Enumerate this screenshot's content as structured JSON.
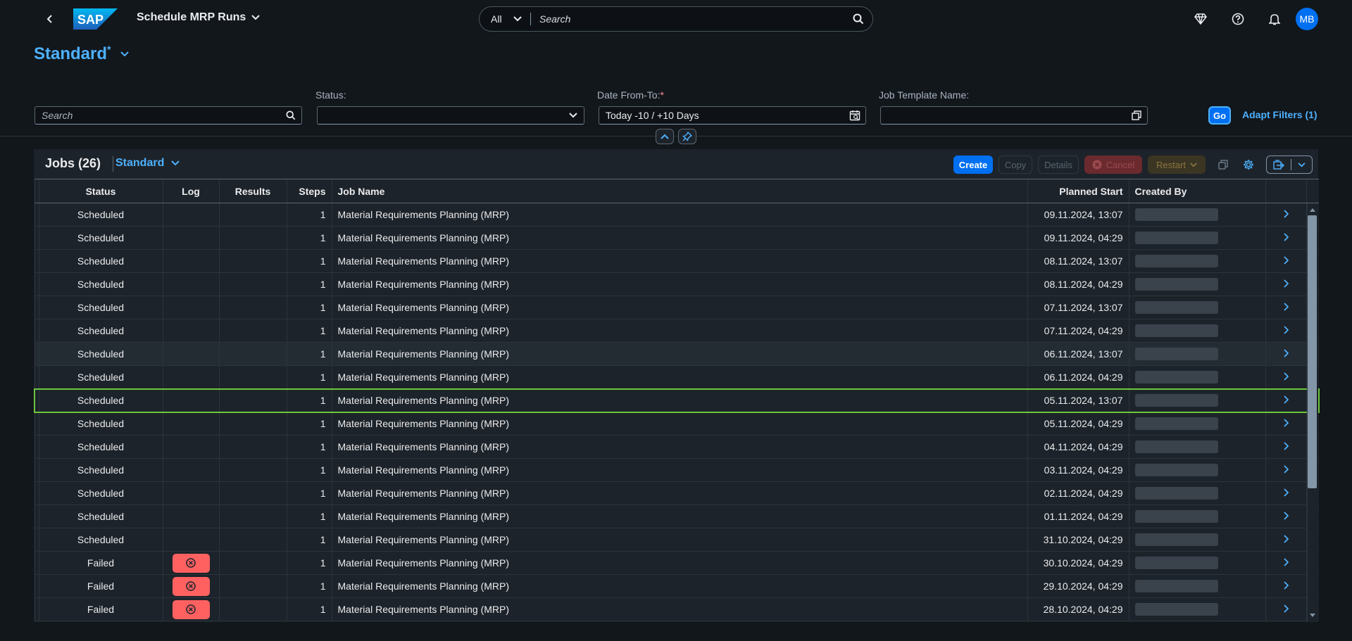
{
  "shell": {
    "logo_text": "SAP",
    "app_title": "Schedule MRP Runs",
    "search_scope": "All",
    "search_placeholder": "Search",
    "avatar_initials": "MB"
  },
  "variant": {
    "title": "Standard",
    "modified_marker": "*"
  },
  "filters": {
    "search_placeholder": "Search",
    "status_label": "Status:",
    "status_value": "",
    "date_label": "Date From-To:",
    "date_required_marker": "*",
    "date_value": "Today -10 / +10 Days",
    "template_label": "Job Template Name:",
    "template_value": "",
    "go_label": "Go",
    "adapt_label": "Adapt Filters (1)"
  },
  "table": {
    "title": "Jobs (26)",
    "variant": "Standard",
    "buttons": {
      "create": "Create",
      "copy": "Copy",
      "details": "Details",
      "cancel": "Cancel",
      "restart": "Restart"
    },
    "columns": [
      "Status",
      "Log",
      "Results",
      "Steps",
      "Job Name",
      "Planned Start",
      "Created By"
    ],
    "rows": [
      {
        "status": "Scheduled",
        "log": "",
        "results": "",
        "steps": "1",
        "job": "Material Requirements Planning (MRP)",
        "start": "09.11.2024, 13:07"
      },
      {
        "status": "Scheduled",
        "log": "",
        "results": "",
        "steps": "1",
        "job": "Material Requirements Planning (MRP)",
        "start": "09.11.2024, 04:29"
      },
      {
        "status": "Scheduled",
        "log": "",
        "results": "",
        "steps": "1",
        "job": "Material Requirements Planning (MRP)",
        "start": "08.11.2024, 13:07"
      },
      {
        "status": "Scheduled",
        "log": "",
        "results": "",
        "steps": "1",
        "job": "Material Requirements Planning (MRP)",
        "start": "08.11.2024, 04:29"
      },
      {
        "status": "Scheduled",
        "log": "",
        "results": "",
        "steps": "1",
        "job": "Material Requirements Planning (MRP)",
        "start": "07.11.2024, 13:07"
      },
      {
        "status": "Scheduled",
        "log": "",
        "results": "",
        "steps": "1",
        "job": "Material Requirements Planning (MRP)",
        "start": "07.11.2024, 04:29"
      },
      {
        "status": "Scheduled",
        "log": "",
        "results": "",
        "steps": "1",
        "job": "Material Requirements Planning (MRP)",
        "start": "06.11.2024, 13:07"
      },
      {
        "status": "Scheduled",
        "log": "",
        "results": "",
        "steps": "1",
        "job": "Material Requirements Planning (MRP)",
        "start": "06.11.2024, 04:29"
      },
      {
        "status": "Scheduled",
        "log": "",
        "results": "",
        "steps": "1",
        "job": "Material Requirements Planning (MRP)",
        "start": "05.11.2024, 13:07"
      },
      {
        "status": "Scheduled",
        "log": "",
        "results": "",
        "steps": "1",
        "job": "Material Requirements Planning (MRP)",
        "start": "05.11.2024, 04:29"
      },
      {
        "status": "Scheduled",
        "log": "",
        "results": "",
        "steps": "1",
        "job": "Material Requirements Planning (MRP)",
        "start": "04.11.2024, 04:29"
      },
      {
        "status": "Scheduled",
        "log": "",
        "results": "",
        "steps": "1",
        "job": "Material Requirements Planning (MRP)",
        "start": "03.11.2024, 04:29"
      },
      {
        "status": "Scheduled",
        "log": "",
        "results": "",
        "steps": "1",
        "job": "Material Requirements Planning (MRP)",
        "start": "02.11.2024, 04:29"
      },
      {
        "status": "Scheduled",
        "log": "",
        "results": "",
        "steps": "1",
        "job": "Material Requirements Planning (MRP)",
        "start": "01.11.2024, 04:29"
      },
      {
        "status": "Scheduled",
        "log": "",
        "results": "",
        "steps": "1",
        "job": "Material Requirements Planning (MRP)",
        "start": "31.10.2024, 04:29"
      },
      {
        "status": "Failed",
        "log": "error",
        "results": "",
        "steps": "1",
        "job": "Material Requirements Planning (MRP)",
        "start": "30.10.2024, 04:29"
      },
      {
        "status": "Failed",
        "log": "error",
        "results": "",
        "steps": "1",
        "job": "Material Requirements Planning (MRP)",
        "start": "29.10.2024, 04:29"
      },
      {
        "status": "Failed",
        "log": "error",
        "results": "",
        "steps": "1",
        "job": "Material Requirements Planning (MRP)",
        "start": "28.10.2024, 04:29"
      }
    ]
  },
  "colors": {
    "accent": "#4db1ff",
    "brand": "#0070f2",
    "error_badge": "#ff6161",
    "focus_outline": "#6cc73c",
    "background": "#12171c",
    "panel": "#1d232a"
  },
  "icons": {
    "back": "chevron-left-icon",
    "search": "search-icon",
    "whats_new": "diamond-icon",
    "help": "help-icon",
    "notifications": "bell-icon",
    "status_dropdown": "chevron-down-icon",
    "date_picker": "calendar-icon",
    "template_value_help": "value-help-icon",
    "collapse_header": "chevron-up-icon",
    "pin_header": "pin-icon",
    "copy_table": "copy-icon",
    "settings": "gear-icon",
    "export": "export-icon",
    "log_error": "error-circle-icon",
    "row_navigation": "chevron-right-icon"
  }
}
